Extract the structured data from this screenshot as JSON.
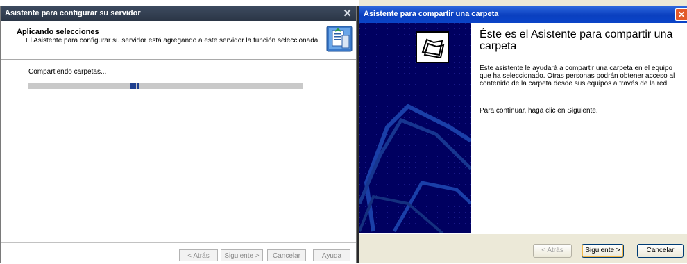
{
  "left_dialog": {
    "title": "Asistente para configurar su servidor",
    "header_title": "Aplicando selecciones",
    "header_subtitle": "El Asistente para configurar su servidor está agregando a este servidor la función seleccionada.",
    "status_text": "Compartiendo carpetas...",
    "progress_icon": "server-wizard-icon",
    "buttons": {
      "back": "< Atrás",
      "next": "Siguiente >",
      "cancel": "Cancelar",
      "help": "Ayuda"
    }
  },
  "right_dialog": {
    "title": "Asistente para compartir una carpeta",
    "heading": "Éste es el Asistente para compartir una carpeta",
    "paragraph1": "Este asistente le ayudará a compartir una carpeta en el equipo que ha seleccionado. Otras personas podrán obtener acceso al contenido de la carpeta desde sus equipos a través de la red.",
    "paragraph2": "Para continuar, haga clic en Siguiente.",
    "buttons": {
      "back": "< Atrás",
      "next": "Siguiente >",
      "cancel": "Cancelar"
    }
  },
  "colors": {
    "left_titlebar": "#2b3646",
    "right_titlebar": "#0a3fbf",
    "wizard_panel": "#000060",
    "progress_block": "#1f3f8f"
  }
}
